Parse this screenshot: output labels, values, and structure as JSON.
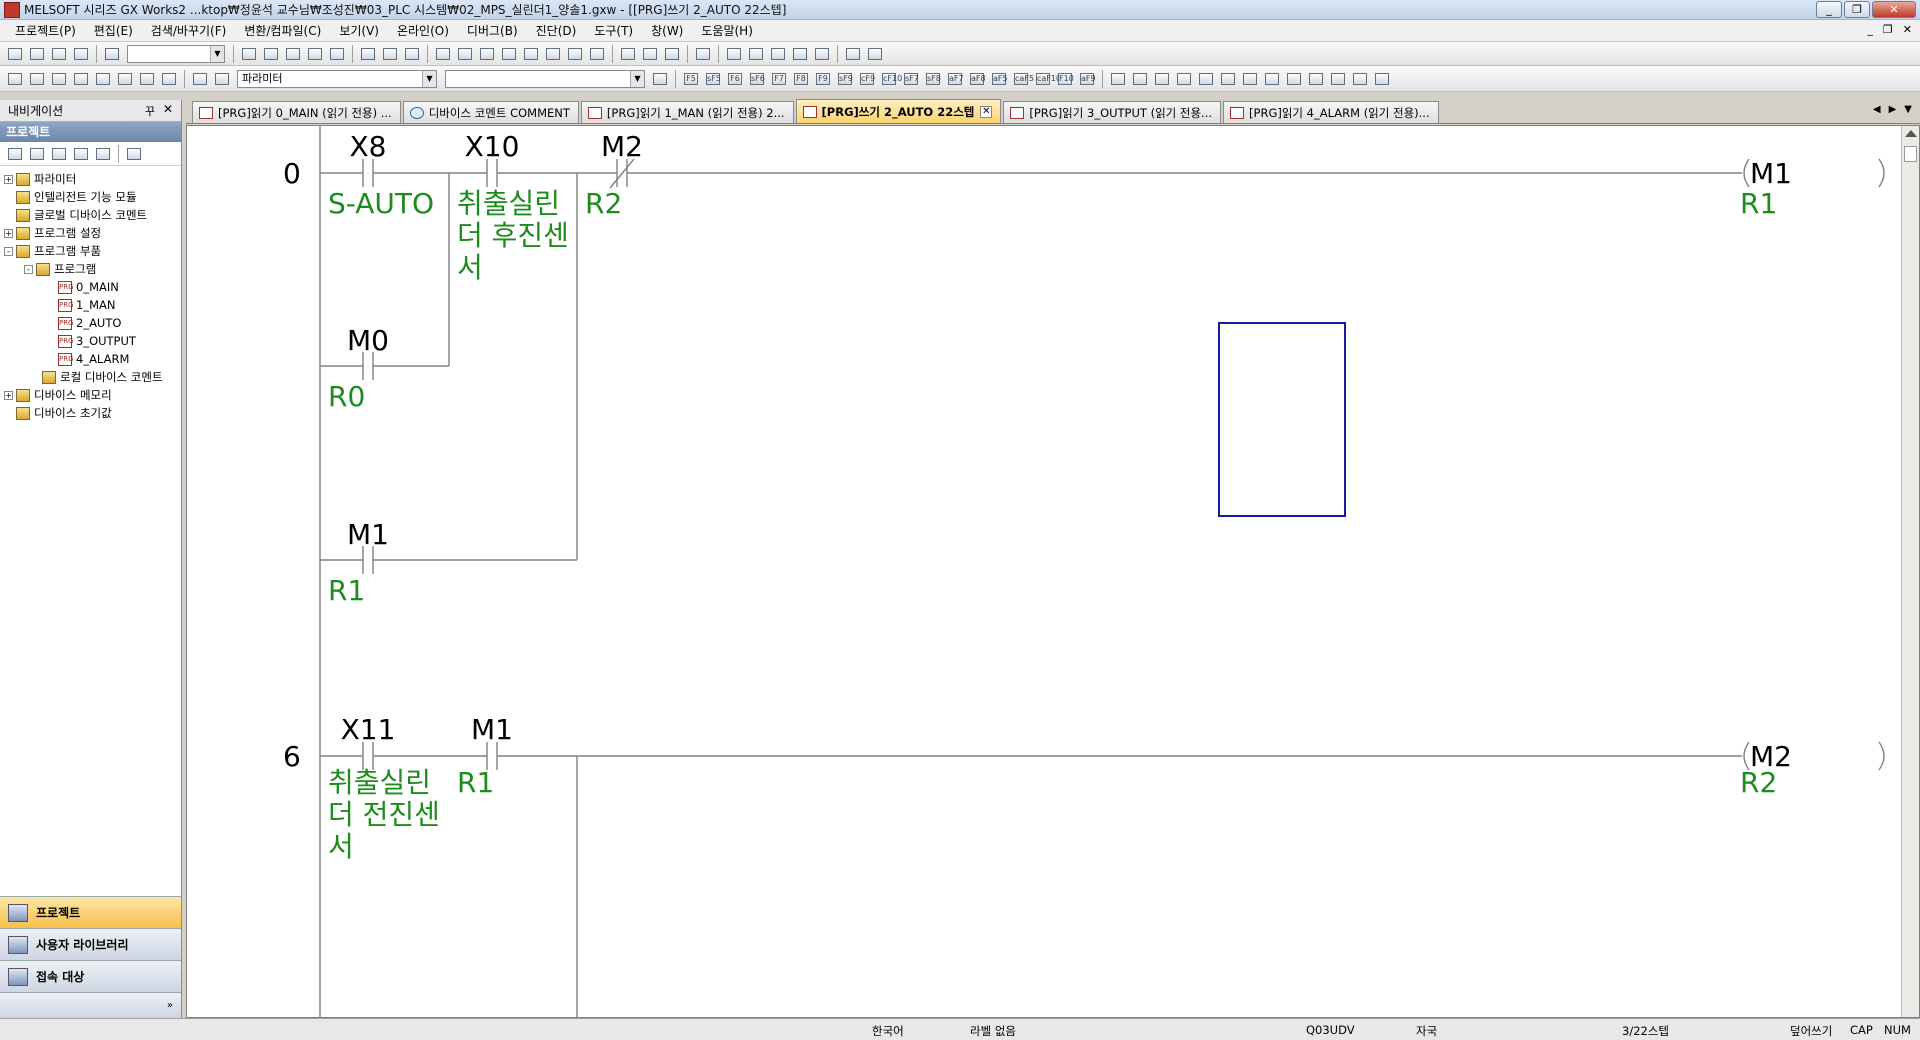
{
  "window": {
    "title": "MELSOFT 시리즈 GX Works2 ...ktop₩정윤석 교수님₩조성진₩03_PLC 시스템₩02_MPS_실린더1_양솔1.gxw - [[PRG]쓰기 2_AUTO 22스텝]",
    "minimize": "_",
    "restore": "❐",
    "close": "✕"
  },
  "menu": {
    "items": [
      "프로젝트(P)",
      "편집(E)",
      "검색/바꾸기(F)",
      "변환/컴파일(C)",
      "보기(V)",
      "온라인(O)",
      "디버그(B)",
      "진단(D)",
      "도구(T)",
      "창(W)",
      "도움말(H)"
    ],
    "mdi_minimize": "_",
    "mdi_restore": "❐",
    "mdi_close": "✕"
  },
  "toolbar": {
    "combo1_value": "",
    "combo2_value": "파라미터",
    "combo3_value": "",
    "fkeys": [
      "F5",
      "sF5",
      "F6",
      "sF6",
      "F7",
      "F8",
      "F9",
      "sF9",
      "cF9",
      "cF10",
      "sF7",
      "sF8",
      "aF7",
      "aF8",
      "aF5",
      "caF5",
      "caF10",
      "F10",
      "aF9"
    ]
  },
  "navigation": {
    "header": "내비게이션",
    "pin": "꾸",
    "close": "✕",
    "section": "프로젝트",
    "tree": [
      {
        "label": "파라미터",
        "level": 0,
        "expander": "+"
      },
      {
        "label": "인텔리전트 기능 모듈",
        "level": 0,
        "expander": ""
      },
      {
        "label": "글로벌 디바이스 코멘트",
        "level": 0,
        "expander": ""
      },
      {
        "label": "프로그램 설정",
        "level": 0,
        "expander": "+"
      },
      {
        "label": "프로그램 부품",
        "level": 0,
        "expander": "-"
      },
      {
        "label": "프로그램",
        "level": 1,
        "expander": "-"
      },
      {
        "label": "0_MAIN",
        "level": 2,
        "expander": ""
      },
      {
        "label": "1_MAN",
        "level": 2,
        "expander": ""
      },
      {
        "label": "2_AUTO",
        "level": 2,
        "expander": ""
      },
      {
        "label": "3_OUTPUT",
        "level": 2,
        "expander": ""
      },
      {
        "label": "4_ALARM",
        "level": 2,
        "expander": ""
      },
      {
        "label": "로컬 디바이스 코멘트",
        "level": 1,
        "expander": ""
      },
      {
        "label": "디바이스 메모리",
        "level": 0,
        "expander": "+"
      },
      {
        "label": "디바이스 초기값",
        "level": 0,
        "expander": ""
      }
    ],
    "bottom_tabs": [
      "프로젝트",
      "사용자 라이브러리",
      "접속 대상"
    ],
    "grip": "»"
  },
  "tabs": [
    {
      "label": "[PRG]읽기 0_MAIN (읽기 전용) ...",
      "icon": "program-icon"
    },
    {
      "label": "디바이스 코멘트 COMMENT",
      "icon": "comment-icon"
    },
    {
      "label": "[PRG]읽기 1_MAN (읽기 전용) 2...",
      "icon": "program-icon"
    },
    {
      "label": "[PRG]쓰기 2_AUTO 22스텝",
      "icon": "program-icon",
      "active": true
    },
    {
      "label": "[PRG]읽기 3_OUTPUT (읽기 전용...",
      "icon": "program-icon"
    },
    {
      "label": "[PRG]읽기 4_ALARM (읽기 전용)...",
      "icon": "program-icon"
    }
  ],
  "tab_nav": {
    "prev": "◀",
    "next": "▶",
    "list": "▼"
  },
  "ladder": {
    "rung0": {
      "step": "0",
      "contacts": [
        {
          "device": "X8",
          "comment": [
            "S-AUTO"
          ],
          "type": "no"
        },
        {
          "device": "X10",
          "comment": [
            "취출실린",
            "더 후진센",
            "서"
          ],
          "type": "no"
        },
        {
          "device": "M2",
          "comment": [
            "R2"
          ],
          "type": "nc"
        },
        {
          "device": "M0",
          "comment": [
            "R0"
          ],
          "type": "no"
        },
        {
          "device": "M1",
          "comment": [
            "R1"
          ],
          "type": "no"
        }
      ],
      "coil": {
        "device": "M1",
        "comment": "R1"
      }
    },
    "rung6": {
      "step": "6",
      "contacts": [
        {
          "device": "X11",
          "comment": [
            "취출실린",
            "더 전진센",
            "서"
          ],
          "type": "no"
        },
        {
          "device": "M1",
          "comment": [
            "R1"
          ],
          "type": "no"
        }
      ],
      "coil": {
        "device": "M2",
        "comment": "R2"
      }
    }
  },
  "status": {
    "language": "한국어",
    "label": "라벨 없음",
    "cpu": "Q03UDV",
    "station": "자국",
    "steps": "3/22스텝",
    "mode": "덮어쓰기",
    "cap": "CAP",
    "num": "NUM"
  }
}
